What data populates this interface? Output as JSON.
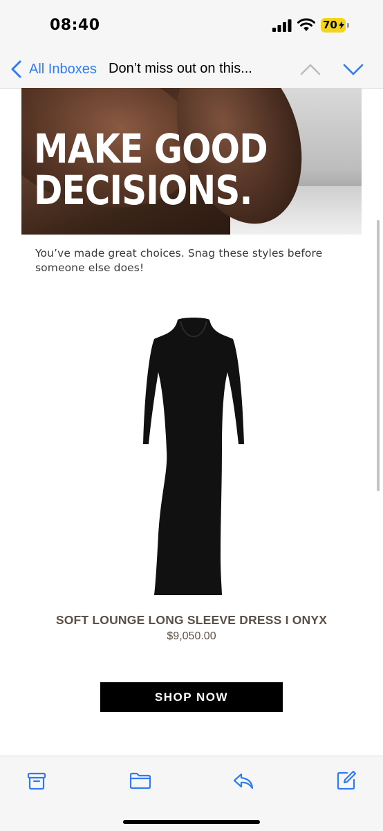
{
  "status_bar": {
    "time": "08:40",
    "battery_level": "70",
    "battery_color": "#f5d51c"
  },
  "nav": {
    "back_label": "All Inboxes",
    "subject": "Don’t miss out on this...",
    "accent_color": "#2f7bf5"
  },
  "email": {
    "hero_title_line1": "MAKE GOOD",
    "hero_title_line2": "DECISIONS.",
    "intro": "You’ve made great choices. Snag these styles before someone else does!",
    "product": {
      "name": "SOFT LOUNGE LONG SLEEVE DRESS I ONYX",
      "price": "$9,050.00",
      "image_icon": "black-long-sleeve-dress-image"
    },
    "cta_label": "SHOP NOW"
  },
  "toolbar": {
    "items": [
      "archive-icon",
      "folder-icon",
      "reply-icon",
      "compose-icon"
    ]
  }
}
